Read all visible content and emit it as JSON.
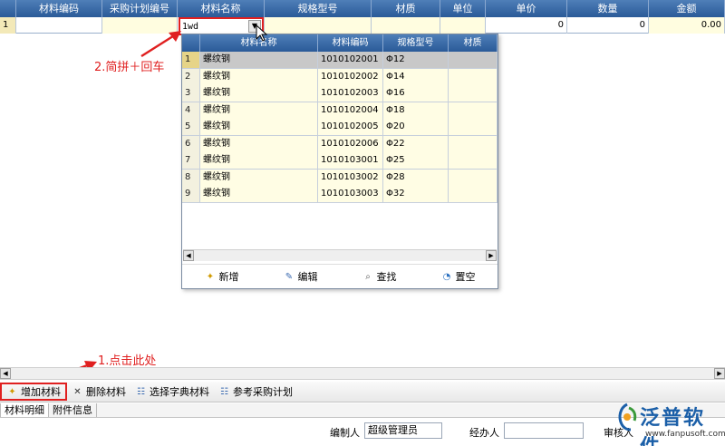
{
  "main_grid": {
    "headers": [
      "材料编码",
      "采购计划编号",
      "材料名称",
      "规格型号",
      "材质",
      "单位",
      "单价",
      "数量",
      "金额"
    ],
    "row": {
      "index": "1",
      "unit_price": "0",
      "quantity": "0",
      "amount": "0.00"
    }
  },
  "combo": {
    "value": "1wd"
  },
  "popup": {
    "headers": [
      "材料名称",
      "材料编码",
      "规格型号",
      "材质"
    ],
    "rows": [
      {
        "idx": "1",
        "name": "螺纹钢",
        "code": "1010102001",
        "spec": "Φ12",
        "material": ""
      },
      {
        "idx": "2",
        "name": "螺纹钢",
        "code": "1010102002",
        "spec": "Φ14",
        "material": ""
      },
      {
        "idx": "3",
        "name": "螺纹钢",
        "code": "1010102003",
        "spec": "Φ16",
        "material": ""
      },
      {
        "idx": "4",
        "name": "螺纹钢",
        "code": "1010102004",
        "spec": "Φ18",
        "material": ""
      },
      {
        "idx": "5",
        "name": "螺纹钢",
        "code": "1010102005",
        "spec": "Φ20",
        "material": ""
      },
      {
        "idx": "6",
        "name": "螺纹钢",
        "code": "1010102006",
        "spec": "Φ22",
        "material": ""
      },
      {
        "idx": "7",
        "name": "螺纹钢",
        "code": "1010103001",
        "spec": "Φ25",
        "material": ""
      },
      {
        "idx": "8",
        "name": "螺纹钢",
        "code": "1010103002",
        "spec": "Φ28",
        "material": ""
      },
      {
        "idx": "9",
        "name": "螺纹钢",
        "code": "1010103003",
        "spec": "Φ32",
        "material": ""
      }
    ],
    "toolbar": {
      "add": "新增",
      "edit": "编辑",
      "find": "查找",
      "clear": "置空"
    }
  },
  "annotations": {
    "step2": "2.简拼＋回车",
    "step1": "1.点击此处"
  },
  "toolbar": {
    "add_material": "增加材料",
    "delete_material": "删除材料",
    "select_dict": "选择字典材料",
    "ref_plan": "参考采购计划"
  },
  "tabs": [
    "材料明细",
    "附件信息"
  ],
  "footer": {
    "maker_label": "编制人",
    "maker_value": "超级管理员",
    "handler_label": "经办人",
    "handler_value": "",
    "reviewer_label": "审核人"
  },
  "logo": {
    "brand": "泛普软件",
    "url": "www.fanpusoft.com"
  },
  "colors": {
    "accent_red": "#e02020",
    "header_blue": "#2a5a98",
    "row_yellow": "#fffde4",
    "brand_blue": "#1b5fa8"
  }
}
